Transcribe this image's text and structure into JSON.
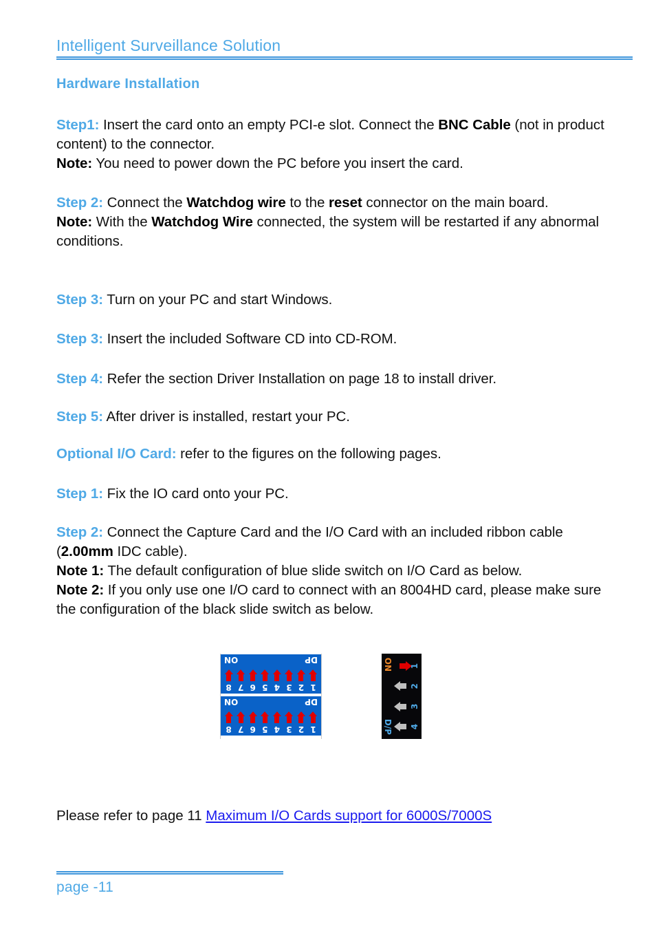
{
  "header": {
    "title": "Intelligent Surveillance Solution"
  },
  "section": {
    "heading": "Hardware Installation"
  },
  "steps": [
    {
      "label": "Step1:",
      "lines": [
        {
          "parts": [
            {
              "text": " Insert the card onto an empty PCI-e slot. Connect the "
            },
            {
              "text": "BNC Cable",
              "bold": true
            },
            {
              "text": " (not in product content) to the connector."
            }
          ]
        }
      ],
      "note_label": "Note:",
      "note_parts": [
        {
          "text": " You need to power down the PC before you insert the card."
        }
      ]
    },
    {
      "label": "Step 2:",
      "lines": [
        {
          "parts": [
            {
              "text": " Connect the "
            },
            {
              "text": "Watchdog wire",
              "bold": true
            },
            {
              "text": " to the "
            },
            {
              "text": "reset",
              "bold": true
            },
            {
              "text": " connector on the main board."
            }
          ]
        }
      ],
      "note_label": "Note:",
      "note_parts": [
        {
          "text": " With the "
        },
        {
          "text": "Watchdog Wire",
          "bold": true
        },
        {
          "text": " connected, the system will be restarted if any abnormal conditions."
        }
      ]
    },
    {
      "label": "Step 3:",
      "lines": [
        {
          "parts": [
            {
              "text": " Turn on your PC and start Windows."
            }
          ]
        }
      ]
    },
    {
      "label": "Step 3:",
      "lines": [
        {
          "parts": [
            {
              "text": " Insert the included Software CD into CD-ROM."
            }
          ]
        }
      ]
    },
    {
      "label": "Step 4:",
      "lines": [
        {
          "parts": [
            {
              "text": " Refer the section Driver Installation on page 18 to install driver."
            }
          ]
        }
      ]
    },
    {
      "label": "Step 5:",
      "lines": [
        {
          "parts": [
            {
              "text": " After driver is installed, restart your PC."
            }
          ]
        }
      ]
    },
    {
      "label": "Optional I/O Card:",
      "lines": [
        {
          "parts": [
            {
              "text": " refer to the figures on the following pages."
            }
          ]
        }
      ]
    },
    {
      "label": "Step 1:",
      "lines": [
        {
          "parts": [
            {
              "text": " Fix the IO card onto your PC."
            }
          ]
        }
      ]
    },
    {
      "label": "Step 2:",
      "lines": [
        {
          "parts": [
            {
              "text": " Connect the Capture Card and the I/O Card with an included ribbon cable ("
            },
            {
              "text": "2.00mm",
              "bold": true
            },
            {
              "text": " IDC cable)."
            }
          ]
        }
      ],
      "note_label": "Note 1:",
      "note_parts": [
        {
          "text": " The default configuration of blue slide switch on I/O Card as below."
        }
      ],
      "note2_label": "Note 2:",
      "note2_parts": [
        {
          "text": " If you only use one I/O card to connect with an 8004HD card, please make sure the configuration of the black slide switch as below."
        }
      ]
    }
  ],
  "figures": {
    "blue_switch": {
      "name": "blue-slide-switch",
      "panels": 2,
      "positions": [
        "1",
        "2",
        "3",
        "4",
        "5",
        "6",
        "7",
        "8"
      ],
      "left_label": "DP",
      "right_label": "ON",
      "arrow_direction": "down",
      "arrow_color": "#E00000",
      "background_color": "#0A62C8",
      "orientation": "rotated-180"
    },
    "black_switch": {
      "name": "black-slide-switch",
      "positions": [
        "1",
        "2",
        "3",
        "4"
      ],
      "top_label": "D/P",
      "bottom_label": "ON",
      "states": [
        "on",
        "off",
        "off",
        "off"
      ],
      "on_arrow_color": "#E00000",
      "off_arrow_color": "#BFBFBF",
      "background_color": "#07070A",
      "orientation": "rotated-90"
    }
  },
  "reference": {
    "prefix": "Please refer to page 11 ",
    "link_text": "Maximum I/O Cards support for 6000S/7000S"
  },
  "footer": {
    "page_label": "page -11"
  },
  "colors": {
    "accent_blue": "#4FA9E6",
    "rule_blue": "#3F96DC",
    "link_blue": "#1A1AEE",
    "body_black": "#111111"
  }
}
